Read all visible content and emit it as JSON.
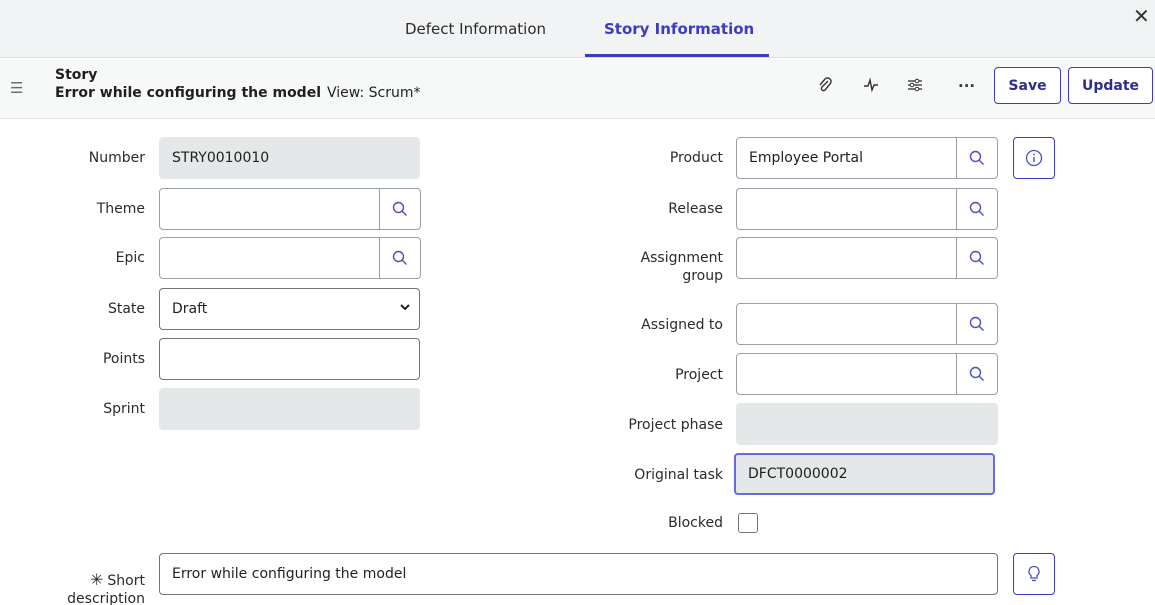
{
  "tabs": [
    {
      "label": "Defect Information",
      "active": false
    },
    {
      "label": "Story Information",
      "active": true
    }
  ],
  "header": {
    "record_type": "Story",
    "title": "Error while configuring the model",
    "view": "View: Scrum*",
    "save_label": "Save",
    "update_label": "Update",
    "icons": [
      "paperclip-icon",
      "activity-icon",
      "settings-sliders-icon",
      "more-icon"
    ]
  },
  "left_fields": {
    "number": {
      "label": "Number",
      "value": "STRY0010010"
    },
    "theme": {
      "label": "Theme",
      "value": ""
    },
    "epic": {
      "label": "Epic",
      "value": ""
    },
    "state": {
      "label": "State",
      "value": "Draft"
    },
    "points": {
      "label": "Points",
      "value": ""
    },
    "sprint": {
      "label": "Sprint",
      "value": ""
    }
  },
  "right_fields": {
    "product": {
      "label": "Product",
      "value": "Employee Portal"
    },
    "release": {
      "label": "Release",
      "value": ""
    },
    "assignment_group": {
      "label": "Assignment group",
      "value": ""
    },
    "assigned_to": {
      "label": "Assigned to",
      "value": ""
    },
    "project": {
      "label": "Project",
      "value": ""
    },
    "project_phase": {
      "label": "Project phase",
      "value": ""
    },
    "original_task": {
      "label": "Original task",
      "value": "DFCT0000002"
    },
    "blocked": {
      "label": "Blocked",
      "checked": false
    }
  },
  "short_description": {
    "required_mark": "✳",
    "label": "Short description",
    "value": "Error while configuring the model"
  },
  "colors": {
    "accent": "#3b3bc4",
    "readonly_bg": "#e5e8e8"
  }
}
